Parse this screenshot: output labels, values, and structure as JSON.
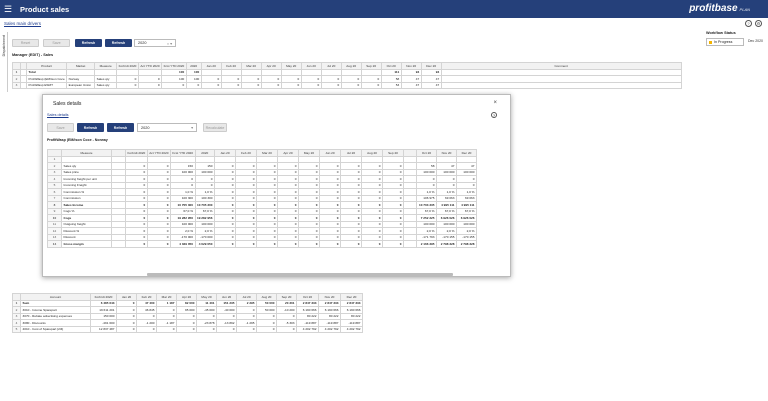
{
  "app": {
    "title": "Product sales",
    "logo": "profitbase",
    "logo_sub": "PLAN",
    "menu_icon": "menu-icon"
  },
  "nav": {
    "sublink": "Sales main drivers",
    "side_tab": "Dispatchment"
  },
  "toolbar": {
    "reset": "Reset",
    "save": "Save",
    "refresh": "Refresh",
    "refresh2": "Refresh",
    "year": "2020"
  },
  "workflow": {
    "label": "Workflow Status",
    "value": "In Progress",
    "date": "Dec 2020",
    "color": "#f4b400"
  },
  "main_table": {
    "title": "Manager (EDIT) - Sales",
    "headers": [
      "",
      "",
      "Product",
      "Market",
      "Measure",
      "Forbrdt 2020",
      "Act YTD 2020",
      "Fcst YTD 2020",
      "2020",
      "Jan 20",
      "Feb 20",
      "Mar 20",
      "Apr 20",
      "May 20",
      "Jun 20",
      "Jul 20",
      "Aug 20",
      "Sep 20",
      "Oct 20",
      "Nov 20",
      "Dec 20",
      "Comment"
    ],
    "rows": [
      [
        "1",
        "",
        "Total",
        "",
        "",
        "",
        "",
        "100",
        "100",
        "",
        "",
        "",
        "",
        "",
        "",
        "",
        "",
        "",
        "111",
        "94",
        "94",
        ""
      ],
      [
        "2",
        "",
        "ProfitWasp (EM/ison Coce",
        "Norway",
        "Sales qty",
        "0",
        "0",
        "100",
        "100",
        "0",
        "0",
        "0",
        "0",
        "0",
        "0",
        "0",
        "0",
        "0",
        "58",
        "47",
        "47",
        ""
      ],
      [
        "3",
        "",
        "ProfitWasp ESMT",
        "European Union",
        "Sales qty",
        "0",
        "0",
        "0",
        "0",
        "0",
        "0",
        "0",
        "0",
        "0",
        "0",
        "0",
        "0",
        "0",
        "53",
        "47",
        "47",
        ""
      ]
    ]
  },
  "dialog": {
    "title": "Sales details",
    "close": "×",
    "link": "Sales details",
    "reset": "Save",
    "refresh": "Refresh",
    "refresh2": "Refresh",
    "year": "2020",
    "recalc": "Recalculate",
    "subtitle": "ProfitWasp (EM/ison Coce - Norway",
    "headers": [
      "",
      "Measure",
      "",
      "Forbrdt 2020",
      "Act YTD 2020",
      "Fcst YTD 2020",
      "2020",
      "Jan 20",
      "Feb 20",
      "Mar 20",
      "Apr 20",
      "May 20",
      "Jun 20",
      "Jul 20",
      "Aug 20",
      "Sep 20",
      "",
      "Oct 20",
      "Nov 20",
      "Dec 20"
    ],
    "rows": [
      [
        "1",
        "",
        "",
        "",
        "",
        "",
        "",
        "",
        "",
        "",
        "",
        "",
        "",
        "",
        "",
        "",
        "",
        "",
        "",
        ""
      ],
      [
        "2",
        "Sales qty",
        "",
        "0",
        "0",
        "150",
        "150",
        "0",
        "0",
        "0",
        "0",
        "0",
        "0",
        "0",
        "0",
        "0",
        "",
        "58",
        "47",
        "47"
      ],
      [
        "3",
        "Sales price",
        "",
        "0",
        "0",
        "100 000",
        "100 000",
        "0",
        "0",
        "0",
        "0",
        "0",
        "0",
        "0",
        "0",
        "0",
        "",
        "100 000",
        "100 000",
        "100 000"
      ],
      [
        "4",
        "Incoming freight per unit",
        "",
        "0",
        "0",
        "0",
        "0",
        "0",
        "0",
        "0",
        "0",
        "0",
        "0",
        "0",
        "0",
        "0",
        "",
        "0",
        "0",
        "0"
      ],
      [
        "5",
        "Incoming Freight",
        "",
        "0",
        "0",
        "0",
        "0",
        "0",
        "0",
        "0",
        "0",
        "0",
        "0",
        "0",
        "0",
        "0",
        "",
        "0",
        "0",
        "0"
      ],
      [
        "6",
        "Commission %",
        "",
        "0",
        "0",
        "1,0 %",
        "1,0 %",
        "0",
        "0",
        "0",
        "0",
        "0",
        "0",
        "0",
        "0",
        "0",
        "",
        "1,0 %",
        "1,0 %",
        "1,0 %"
      ],
      [
        "7",
        "Commission",
        "",
        "0",
        "0",
        "100 300",
        "100 300",
        "0",
        "0",
        "0",
        "0",
        "0",
        "0",
        "0",
        "0",
        "0",
        "",
        "106 975",
        "69 063",
        "69 063"
      ],
      [
        "8",
        "Sales Income",
        "",
        "0",
        "0",
        "10 705 300",
        "10 705 300",
        "0",
        "0",
        "0",
        "0",
        "0",
        "0",
        "0",
        "0",
        "0",
        "",
        "10 703 335",
        "4 995 111",
        "4 995 111"
      ],
      [
        "9",
        "Cogs %",
        "",
        "0",
        "0",
        "67,0 %",
        "67,0 %",
        "0",
        "0",
        "0",
        "0",
        "0",
        "0",
        "0",
        "0",
        "0",
        "",
        "67,0 %",
        "67,0 %",
        "67,0 %"
      ],
      [
        "10",
        "Cogs",
        "",
        "0",
        "0",
        "19 282 956",
        "19 282 956",
        "0",
        "0",
        "0",
        "0",
        "0",
        "0",
        "0",
        "0",
        "0",
        "",
        "7 252 225",
        "6 926 026",
        "6 926 026"
      ],
      [
        "11",
        "Outgoing freight",
        "",
        "0",
        "0",
        "100 000",
        "100 000",
        "0",
        "0",
        "0",
        "0",
        "0",
        "0",
        "0",
        "0",
        "0",
        "",
        "100 000",
        "100 000",
        "100 000"
      ],
      [
        "12",
        "Discount %",
        "",
        "0",
        "0",
        "2,0 %",
        "2,0 %",
        "0",
        "0",
        "0",
        "0",
        "0",
        "0",
        "0",
        "0",
        "0",
        "",
        "2,0 %",
        "2,0 %",
        "2,0 %"
      ],
      [
        "13",
        "Discount",
        "",
        "0",
        "0",
        "-170 000",
        "-170 000",
        "0",
        "0",
        "0",
        "0",
        "0",
        "0",
        "0",
        "0",
        "0",
        "",
        "-171 793",
        "-170 155",
        "-170 155"
      ],
      [
        "14",
        "Gross margin",
        "",
        "0",
        "0",
        "4 029 050",
        "4 029 050",
        "0",
        "0",
        "0",
        "0",
        "0",
        "0",
        "0",
        "0",
        "0",
        "",
        "2 166 395",
        "2 798 328",
        "2 798 328"
      ]
    ],
    "bold_rows": [
      8,
      10,
      14
    ]
  },
  "bottom_table": {
    "headers": [
      "",
      "Account",
      "Forbrdt 2020",
      "Jan 20",
      "Feb 20",
      "Mar 20",
      "Apr 20",
      "May 20",
      "Jun 20",
      "Jul 20",
      "Aug 20",
      "Sep 20",
      "Oct 20",
      "Nov 20",
      "Dec 20"
    ],
    "rows": [
      [
        "1",
        "Sum",
        "6 485 643",
        "0",
        "47 400",
        "1 187",
        "82 000",
        "11 401",
        "151 235",
        "2 295",
        "50 000",
        "20 301",
        "2 847 333",
        "2 847 333",
        "2 847 333"
      ],
      [
        "2",
        "3010 - Income Sparepart",
        "19 611 201",
        "0",
        "46 845",
        "0",
        "95 000",
        "-45 000",
        "-40 000",
        "0",
        "50 000",
        "-10 200",
        "6 190 666",
        "6 190 666",
        "6 190 666"
      ],
      [
        "3",
        "3070 - Rebate advertising expenses",
        "150 000",
        "0",
        "0",
        "0",
        "0",
        "0",
        "0",
        "0",
        "0",
        "0",
        "80 222",
        "80 222",
        "80 222"
      ],
      [
        "4",
        "3080 - Discounts",
        "-491 600",
        "0",
        "-1 200",
        "-1 187",
        "0",
        "-23 878",
        "-13 892",
        "-1 295",
        "0",
        "-5 303",
        "-119 887",
        "-119 887",
        "-119 887"
      ],
      [
        "5",
        "4010 - Cost of Sparepart [2/4]",
        "12 837 487",
        "0",
        "0",
        "0",
        "0",
        "0",
        "0",
        "0",
        "0",
        "0",
        "4 202 792",
        "4 202 792",
        "4 202 792"
      ]
    ]
  }
}
